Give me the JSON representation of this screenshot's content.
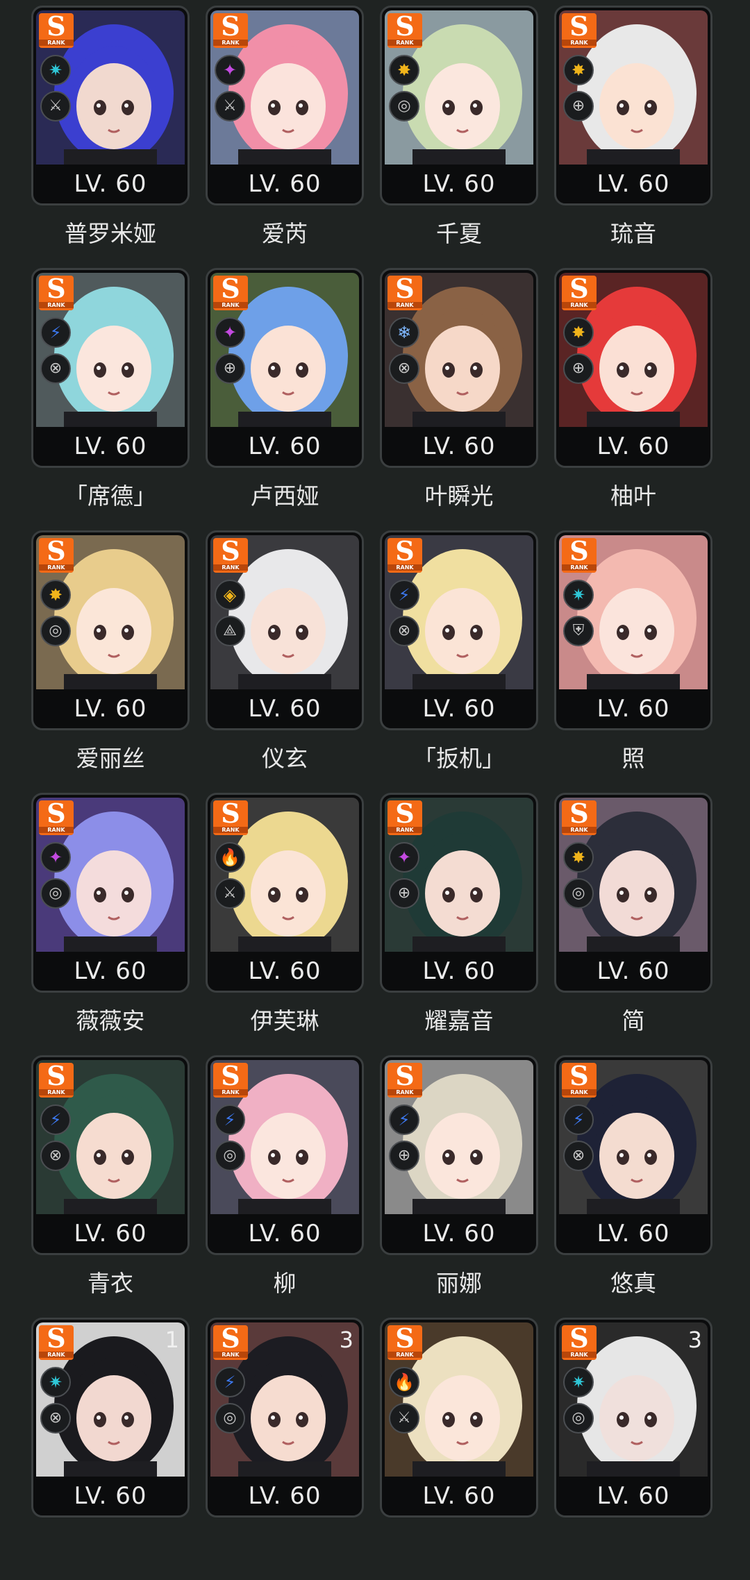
{
  "agents": [
    {
      "name": "普罗米娅",
      "level": "LV. 60",
      "rank": "S",
      "rank_sub": "RANK",
      "attribute": "ice",
      "attr_color": "#2fc6d6",
      "specialty": "attack",
      "hair": "#3b3fd0",
      "skin": "#f1d9cf",
      "bg": "#2a2a55",
      "badge": ""
    },
    {
      "name": "爱芮",
      "level": "LV. 60",
      "rank": "S",
      "rank_sub": "RANK",
      "attribute": "ether",
      "attr_color": "#c34ae0",
      "specialty": "attack",
      "hair": "#f18fa8",
      "skin": "#fbe3dc",
      "bg": "#6c7a99",
      "badge": ""
    },
    {
      "name": "千夏",
      "level": "LV. 60",
      "rank": "S",
      "rank_sub": "RANK",
      "attribute": "physical",
      "attr_color": "#f0b41b",
      "specialty": "anomaly",
      "hair": "#c9dbb1",
      "skin": "#fbe7de",
      "bg": "#8a9aa0",
      "badge": ""
    },
    {
      "name": "琉音",
      "level": "LV. 60",
      "rank": "S",
      "rank_sub": "RANK",
      "attribute": "physical",
      "attr_color": "#f0b41b",
      "specialty": "support",
      "hair": "#e8e8e8",
      "skin": "#fbe2d3",
      "bg": "#6a3a3a",
      "badge": ""
    },
    {
      "name": "「席德」",
      "level": "LV. 60",
      "rank": "S",
      "rank_sub": "RANK",
      "attribute": "electric",
      "attr_color": "#3c78f0",
      "specialty": "stun",
      "hair": "#8fd6dc",
      "skin": "#fbe6dd",
      "bg": "#505a5c",
      "badge": ""
    },
    {
      "name": "卢西娅",
      "level": "LV. 60",
      "rank": "S",
      "rank_sub": "RANK",
      "attribute": "ether",
      "attr_color": "#c34ae0",
      "specialty": "support",
      "hair": "#6ea0e8",
      "skin": "#fbe2d6",
      "bg": "#4a5d3a",
      "badge": ""
    },
    {
      "name": "叶瞬光",
      "level": "LV. 60",
      "rank": "S",
      "rank_sub": "RANK",
      "attribute": "frost",
      "attr_color": "#7fb8ff",
      "specialty": "stun",
      "hair": "#8a6245",
      "skin": "#f6d8c8",
      "bg": "#3a3030",
      "badge": ""
    },
    {
      "name": "柚叶",
      "level": "LV. 60",
      "rank": "S",
      "rank_sub": "RANK",
      "attribute": "physical",
      "attr_color": "#f0b41b",
      "specialty": "support",
      "hair": "#e53a3a",
      "skin": "#fbe0d5",
      "bg": "#5a2424",
      "badge": ""
    },
    {
      "name": "爱丽丝",
      "level": "LV. 60",
      "rank": "S",
      "rank_sub": "RANK",
      "attribute": "physical",
      "attr_color": "#f0b41b",
      "specialty": "anomaly",
      "hair": "#e8cc8c",
      "skin": "#fbe6d8",
      "bg": "#7a6a50",
      "badge": ""
    },
    {
      "name": "仪玄",
      "level": "LV. 60",
      "rank": "S",
      "rank_sub": "RANK",
      "attribute": "honed",
      "attr_color": "#f0b41b",
      "specialty": "rupture",
      "hair": "#e8e8ea",
      "skin": "#f8e2d8",
      "bg": "#3a3a3e",
      "badge": ""
    },
    {
      "name": "「扳机」",
      "level": "LV. 60",
      "rank": "S",
      "rank_sub": "RANK",
      "attribute": "electric",
      "attr_color": "#3c78f0",
      "specialty": "stun",
      "hair": "#f0dfa0",
      "skin": "#fbe4d6",
      "bg": "#3a3a44",
      "badge": ""
    },
    {
      "name": "照",
      "level": "LV. 60",
      "rank": "S",
      "rank_sub": "RANK",
      "attribute": "ice",
      "attr_color": "#2fc6d6",
      "specialty": "defense",
      "hair": "#f3b9b0",
      "skin": "#fbe4dc",
      "bg": "#c98a8a",
      "badge": ""
    },
    {
      "name": "薇薇安",
      "level": "LV. 60",
      "rank": "S",
      "rank_sub": "RANK",
      "attribute": "ether",
      "attr_color": "#c34ae0",
      "specialty": "anomaly",
      "hair": "#8c8ee8",
      "skin": "#f4dcdc",
      "bg": "#4a3a7a",
      "badge": ""
    },
    {
      "name": "伊芙琳",
      "level": "LV. 60",
      "rank": "S",
      "rank_sub": "RANK",
      "attribute": "fire",
      "attr_color": "#f04a1a",
      "specialty": "attack",
      "hair": "#ecd890",
      "skin": "#fbe4d6",
      "bg": "#3a3a3a",
      "badge": ""
    },
    {
      "name": "耀嘉音",
      "level": "LV. 60",
      "rank": "S",
      "rank_sub": "RANK",
      "attribute": "ether",
      "attr_color": "#c34ae0",
      "specialty": "support",
      "hair": "#1f3a36",
      "skin": "#f4dcd2",
      "bg": "#2a3a36",
      "badge": ""
    },
    {
      "name": "简",
      "level": "LV. 60",
      "rank": "S",
      "rank_sub": "RANK",
      "attribute": "physical",
      "attr_color": "#f0b41b",
      "specialty": "anomaly",
      "hair": "#2c2e3a",
      "skin": "#f2dbd6",
      "bg": "#6a5a6a",
      "badge": ""
    },
    {
      "name": "青衣",
      "level": "LV. 60",
      "rank": "S",
      "rank_sub": "RANK",
      "attribute": "electric",
      "attr_color": "#3c78f0",
      "specialty": "stun",
      "hair": "#2f5a4a",
      "skin": "#f6dcd0",
      "bg": "#2a3a34",
      "badge": ""
    },
    {
      "name": "柳",
      "level": "LV. 60",
      "rank": "S",
      "rank_sub": "RANK",
      "attribute": "electric",
      "attr_color": "#3c78f0",
      "specialty": "anomaly",
      "hair": "#f0b0c4",
      "skin": "#fbe6de",
      "bg": "#4a4a5a",
      "badge": ""
    },
    {
      "name": "丽娜",
      "level": "LV. 60",
      "rank": "S",
      "rank_sub": "RANK",
      "attribute": "electric",
      "attr_color": "#3c78f0",
      "specialty": "support",
      "hair": "#dcd6c4",
      "skin": "#fbe6dc",
      "bg": "#8a8a8a",
      "badge": ""
    },
    {
      "name": "悠真",
      "level": "LV. 60",
      "rank": "S",
      "rank_sub": "RANK",
      "attribute": "electric",
      "attr_color": "#3c78f0",
      "specialty": "stun",
      "hair": "#1e2236",
      "skin": "#f4dcd0",
      "bg": "#3a3a3a",
      "badge": ""
    },
    {
      "name": "",
      "level": "LV. 60",
      "rank": "S",
      "rank_sub": "RANK",
      "attribute": "ice",
      "attr_color": "#2fc6d6",
      "specialty": "stun",
      "hair": "#1a1a1e",
      "skin": "#f2d8d0",
      "bg": "#d0d0d0",
      "badge": "1"
    },
    {
      "name": "",
      "level": "LV. 60",
      "rank": "S",
      "rank_sub": "RANK",
      "attribute": "electric",
      "attr_color": "#3c78f0",
      "specialty": "anomaly",
      "hair": "#1c1c22",
      "skin": "#f6dcd0",
      "bg": "#5a3a3a",
      "badge": "3"
    },
    {
      "name": "",
      "level": "LV. 60",
      "rank": "S",
      "rank_sub": "RANK",
      "attribute": "fire",
      "attr_color": "#f04a1a",
      "specialty": "attack",
      "hair": "#ece0c0",
      "skin": "#fbe6da",
      "bg": "#4a3a2a",
      "badge": ""
    },
    {
      "name": "",
      "level": "LV. 60",
      "rank": "S",
      "rank_sub": "RANK",
      "attribute": "ice",
      "attr_color": "#2fc6d6",
      "specialty": "anomaly",
      "hair": "#e6e6e6",
      "skin": "#f0e0dc",
      "bg": "#2a2a2a",
      "badge": "3"
    }
  ]
}
